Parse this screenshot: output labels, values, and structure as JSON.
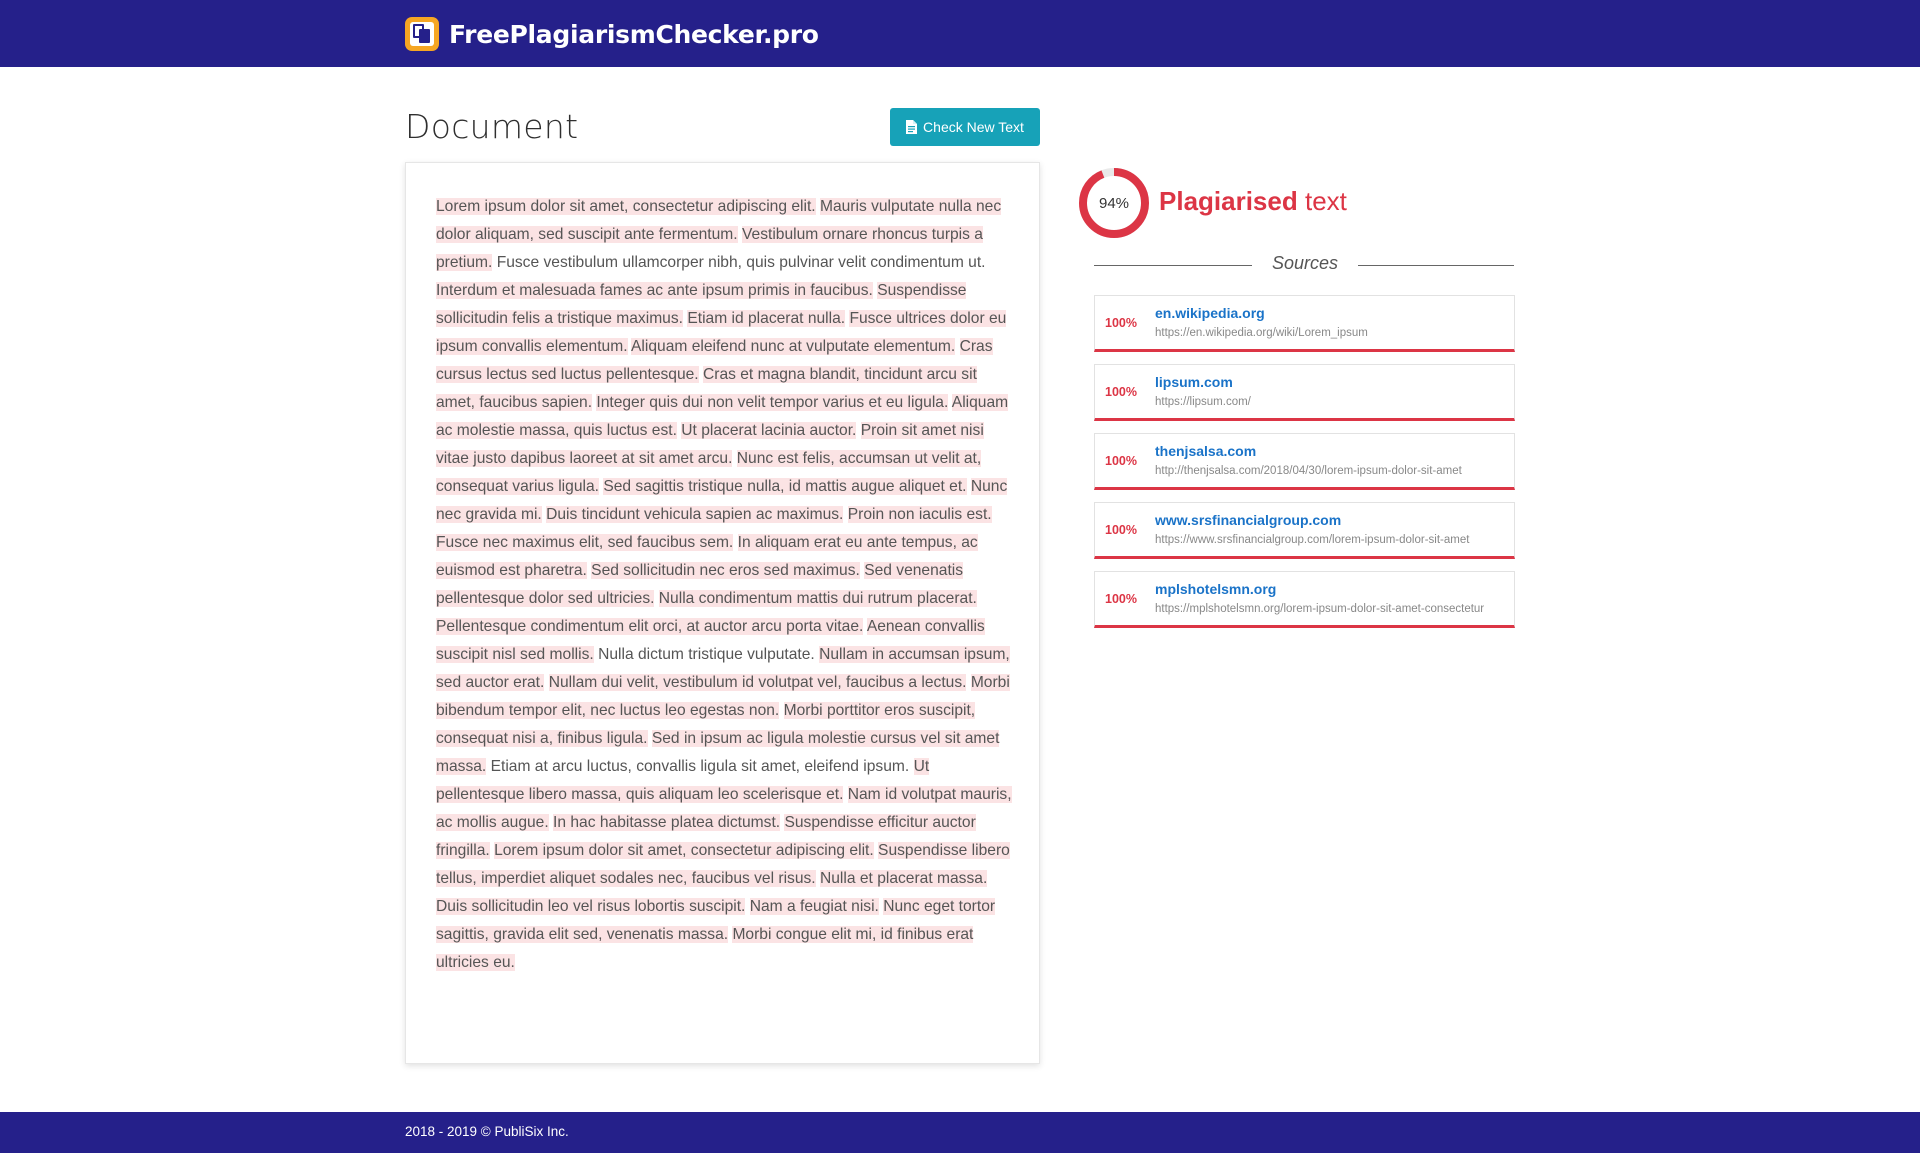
{
  "header": {
    "brand": "FreePlagiarismChecker.pro",
    "logo_icon": "documents-icon",
    "background_color": "#25208a",
    "logo_color": "#f6a623"
  },
  "document": {
    "heading": "Document",
    "check_button_label": "Check New Text",
    "check_button_icon": "file-text-icon",
    "check_button_color": "#17a2b8",
    "highlight_color": "#fbe3e4",
    "sentences": [
      {
        "text": "Lorem ipsum dolor sit amet, consectetur adipiscing elit.",
        "plagiarised": true
      },
      {
        "text": "Mauris vulputate nulla nec dolor aliquam, sed suscipit ante fermentum.",
        "plagiarised": true
      },
      {
        "text": "Vestibulum ornare rhoncus turpis a pretium.",
        "plagiarised": true
      },
      {
        "text": "Fusce vestibulum ullamcorper nibh, quis pulvinar velit condimentum ut.",
        "plagiarised": false
      },
      {
        "text": "Interdum et malesuada fames ac ante ipsum primis in faucibus.",
        "plagiarised": true
      },
      {
        "text": "Suspendisse sollicitudin felis a tristique maximus.",
        "plagiarised": true
      },
      {
        "text": "Etiam id placerat nulla.",
        "plagiarised": true
      },
      {
        "text": "Fusce ultrices dolor eu ipsum convallis elementum.",
        "plagiarised": true
      },
      {
        "text": "Aliquam eleifend nunc at vulputate elementum.",
        "plagiarised": true
      },
      {
        "text": "Cras cursus lectus sed luctus pellentesque.",
        "plagiarised": true
      },
      {
        "text": "Cras et magna blandit, tincidunt arcu sit amet, faucibus sapien.",
        "plagiarised": true
      },
      {
        "text": "Integer quis dui non velit tempor varius et eu ligula.",
        "plagiarised": true
      },
      {
        "text": "Aliquam ac molestie massa, quis luctus est.",
        "plagiarised": true
      },
      {
        "text": "Ut placerat lacinia auctor.",
        "plagiarised": true
      },
      {
        "text": "Proin sit amet nisi vitae justo dapibus laoreet at sit amet arcu.",
        "plagiarised": true
      },
      {
        "text": "Nunc est felis, accumsan ut velit at, consequat varius ligula.",
        "plagiarised": true
      },
      {
        "text": "Sed sagittis tristique nulla, id mattis augue aliquet et.",
        "plagiarised": true
      },
      {
        "text": "Nunc nec gravida mi.",
        "plagiarised": true
      },
      {
        "text": "Duis tincidunt vehicula sapien ac maximus.",
        "plagiarised": true
      },
      {
        "text": "Proin non iaculis est.",
        "plagiarised": true
      },
      {
        "text": "Fusce nec maximus elit, sed faucibus sem.",
        "plagiarised": true
      },
      {
        "text": "In aliquam erat eu ante tempus, ac euismod est pharetra.",
        "plagiarised": true
      },
      {
        "text": "Sed sollicitudin nec eros sed maximus.",
        "plagiarised": true
      },
      {
        "text": "Sed venenatis pellentesque dolor sed ultricies.",
        "plagiarised": true
      },
      {
        "text": "Nulla condimentum mattis dui rutrum placerat.",
        "plagiarised": true
      },
      {
        "text": "Pellentesque condimentum elit orci, at auctor arcu porta vitae.",
        "plagiarised": true
      },
      {
        "text": "Aenean convallis suscipit nisl sed mollis.",
        "plagiarised": true
      },
      {
        "text": "Nulla dictum tristique vulputate.",
        "plagiarised": false
      },
      {
        "text": "Nullam in accumsan ipsum, sed auctor erat.",
        "plagiarised": true
      },
      {
        "text": "Nullam dui velit, vestibulum id volutpat vel, faucibus a lectus.",
        "plagiarised": true
      },
      {
        "text": "Morbi bibendum tempor elit, nec luctus leo egestas non.",
        "plagiarised": true
      },
      {
        "text": "Morbi porttitor eros suscipit, consequat nisi a, finibus ligula.",
        "plagiarised": true
      },
      {
        "text": "Sed in ipsum ac ligula molestie cursus vel sit amet massa.",
        "plagiarised": true
      },
      {
        "text": "Etiam at arcu luctus, convallis ligula sit amet, eleifend ipsum.",
        "plagiarised": false
      },
      {
        "text": "Ut pellentesque libero massa, quis aliquam leo scelerisque et.",
        "plagiarised": true
      },
      {
        "text": "Nam id volutpat mauris, ac mollis augue.",
        "plagiarised": true
      },
      {
        "text": "In hac habitasse platea dictumst.",
        "plagiarised": true
      },
      {
        "text": "Suspendisse efficitur auctor fringilla.",
        "plagiarised": true
      },
      {
        "text": "Lorem ipsum dolor sit amet, consectetur adipiscing elit.",
        "plagiarised": true
      },
      {
        "text": "Suspendisse libero tellus, imperdiet aliquet sodales nec, faucibus vel risus.",
        "plagiarised": true
      },
      {
        "text": "Nulla et placerat massa.",
        "plagiarised": true
      },
      {
        "text": "Duis sollicitudin leo vel risus lobortis suscipit.",
        "plagiarised": true
      },
      {
        "text": "Nam a feugiat nisi.",
        "plagiarised": true
      },
      {
        "text": "Nunc eget tortor sagittis, gravida elit sed, venenatis massa.",
        "plagiarised": true
      },
      {
        "text": "Morbi congue elit mi, id finibus erat ultricies eu.",
        "plagiarised": true
      }
    ]
  },
  "result": {
    "percent": 94,
    "percent_label": "94%",
    "title_strong": "Plagiarised",
    "title_light": "text",
    "gauge_color": "#dc3545",
    "gauge_track_color": "#e9e9e9"
  },
  "sources": {
    "label": "Sources",
    "items": [
      {
        "percent": "100%",
        "domain": "en.wikipedia.org",
        "url": "https://en.wikipedia.org/wiki/Lorem_ipsum"
      },
      {
        "percent": "100%",
        "domain": "lipsum.com",
        "url": "https://lipsum.com/"
      },
      {
        "percent": "100%",
        "domain": "thenjsalsa.com",
        "url": "http://thenjsalsa.com/2018/04/30/lorem-ipsum-dolor-sit-amet"
      },
      {
        "percent": "100%",
        "domain": "www.srsfinancialgroup.com",
        "url": "https://www.srsfinancialgroup.com/lorem-ipsum-dolor-sit-amet"
      },
      {
        "percent": "100%",
        "domain": "mplshotelsmn.org",
        "url": "https://mplshotelsmn.org/lorem-ipsum-dolor-sit-amet-consectetur"
      }
    ]
  },
  "footer": {
    "text": "2018 - 2019 © PubliSix Inc."
  }
}
